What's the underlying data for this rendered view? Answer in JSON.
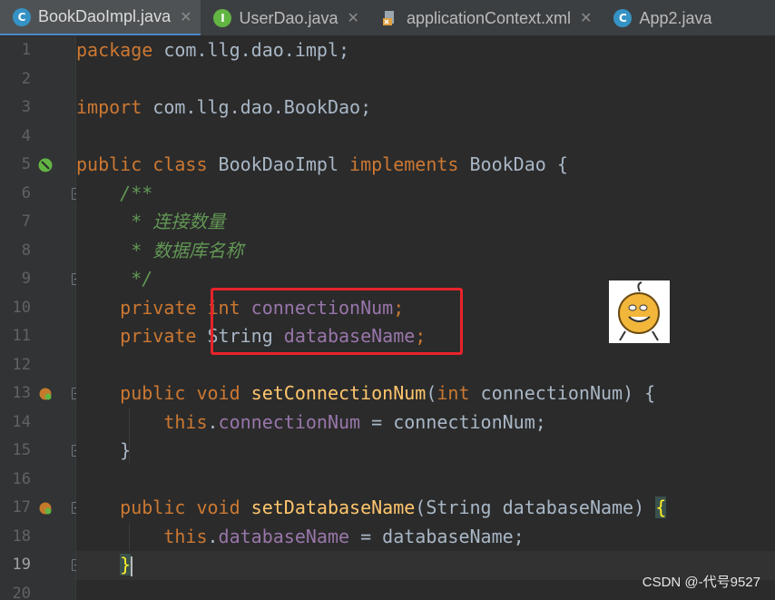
{
  "tabs": [
    {
      "label": "BookDaoImpl.java",
      "icon": "class-icon",
      "active": true,
      "close": "✕"
    },
    {
      "label": "UserDao.java",
      "icon": "interface-icon",
      "active": false,
      "close": "✕"
    },
    {
      "label": "applicationContext.xml",
      "icon": "xml-file-icon",
      "active": false,
      "close": "✕"
    },
    {
      "label": "App2.java",
      "icon": "class-icon",
      "active": false,
      "close": ""
    }
  ],
  "icons": {
    "class": "C",
    "interface": "I"
  },
  "line_numbers": [
    "1",
    "2",
    "3",
    "4",
    "5",
    "6",
    "7",
    "8",
    "9",
    "10",
    "11",
    "12",
    "13",
    "14",
    "15",
    "16",
    "17",
    "18",
    "19",
    "20"
  ],
  "current_line": "19",
  "code": {
    "l1": {
      "kw": "package",
      "rest": " com.llg.dao.impl;"
    },
    "l3": {
      "kw": "import",
      "rest": " com.llg.dao.BookDao;"
    },
    "l5": {
      "kw1": "public class",
      "name": " BookDaoImpl ",
      "kw2": "implements",
      "rest": " BookDao {"
    },
    "l6": {
      "text": "    /**"
    },
    "l7": {
      "text": "     * 连接数量"
    },
    "l8": {
      "text": "     * 数据库名称"
    },
    "l9": {
      "text": "     */"
    },
    "l10": {
      "kw": "    private int",
      "field": " connectionNum",
      "rest": ";"
    },
    "l11": {
      "kw": "    private",
      "type": " String",
      "field": " databaseName",
      "rest": ";"
    },
    "l13": {
      "kw": "    public void",
      "fn": " setConnectionNum",
      "p1": "(",
      "kw2": "int",
      "rest": " connectionNum) {"
    },
    "l14": {
      "kw": "        this",
      "dot": ".",
      "field": "connectionNum",
      "rest": " = connectionNum;"
    },
    "l15": {
      "text": "    }"
    },
    "l17": {
      "kw": "    public void",
      "fn": " setDatabaseName",
      "rest": "(String databaseName) ",
      "brace": "{"
    },
    "l18": {
      "kw": "        this",
      "dot": ".",
      "field": "databaseName",
      "rest": " = databaseName;"
    },
    "l19": {
      "indent": "    ",
      "brace": "}"
    }
  },
  "watermark": "CSDN @-代号9527",
  "colors": {
    "keyword": "#cc7832",
    "field": "#9876aa",
    "method": "#ffc66d",
    "comment": "#629755",
    "highlight_box": "#e8232a"
  }
}
